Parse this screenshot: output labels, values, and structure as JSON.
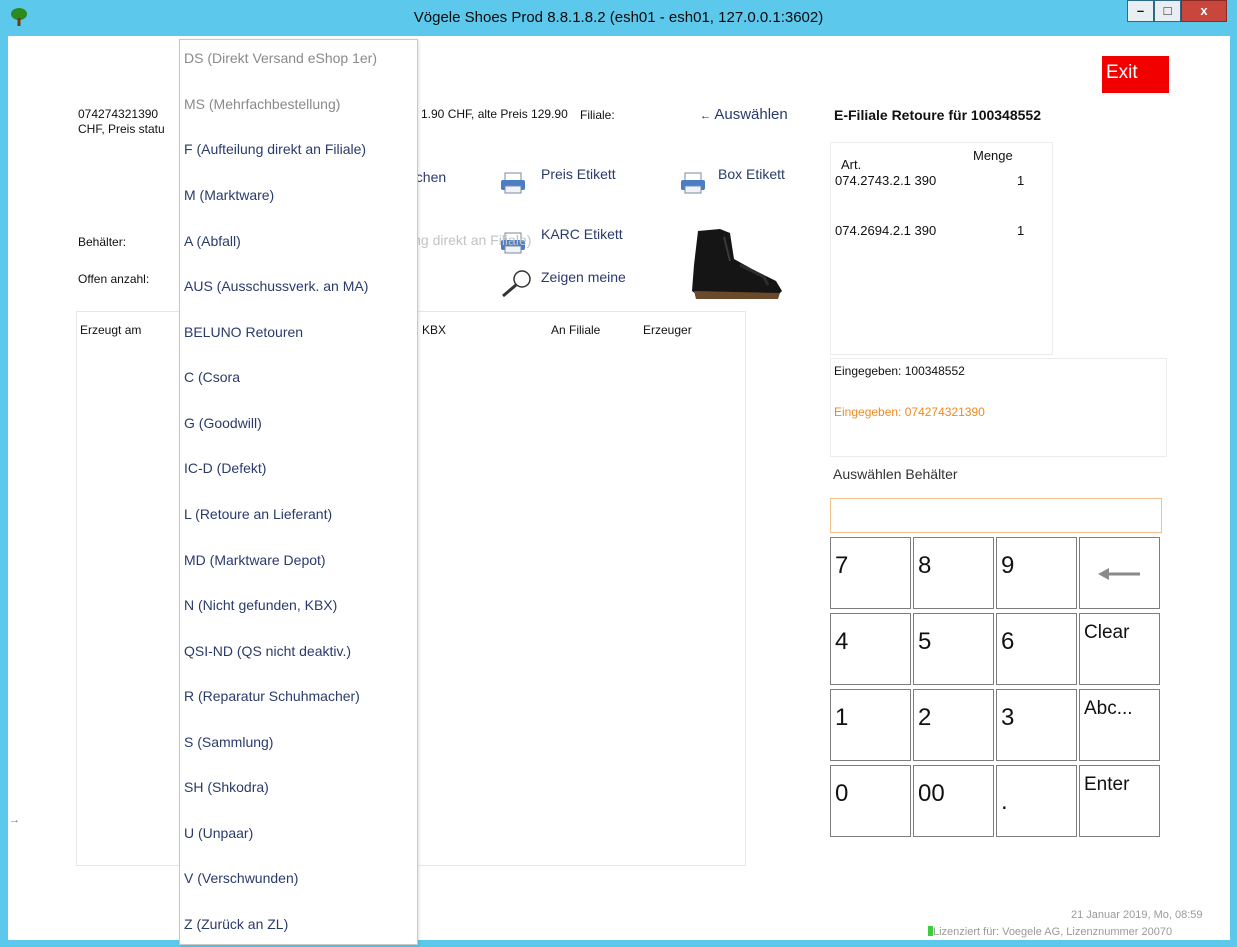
{
  "window": {
    "title": "Vögele Shoes Prod 8.8.1.8.2 (esh01 - esh01, 127.0.0.1:3602)",
    "min_label": "–",
    "max_label": "□",
    "close_label": "x"
  },
  "exit_label": "Exit",
  "product": {
    "code": "074274321390",
    "line2": "CHF, Preis statu",
    "price_text": "1.90 CHF, alte Preis 129.90",
    "filiale_label": "Filiale:",
    "auswaehlen_label": "Auswählen"
  },
  "toolbar": {
    "abbrechen_label": "..bbrechen",
    "preis_etikett": "Preis Etikett",
    "box_etikett": "Box Etikett",
    "karc_etikett": "KARC Etikett",
    "zeigen_meine": "Zeigen meine",
    "hidden_text": "ing direkt an Filiale)"
  },
  "labels": {
    "behaelter": "Behälter:",
    "offen_anzahl": "Offen anzahl:"
  },
  "grid": {
    "columns": [
      "Erzeugt am",
      "KBX",
      "An Filiale",
      "Erzeuger"
    ]
  },
  "dropdown": {
    "items": [
      "DS (Direkt Versand eShop 1er)",
      "MS (Mehrfachbestellung)",
      "F (Aufteilung direkt an Filiale)",
      "M (Marktware)",
      "A (Abfall)",
      "AUS (Ausschussverk. an MA)",
      "BELUNO Retouren",
      "C (Csora",
      "G (Goodwill)",
      "IC-D (Defekt)",
      "L (Retoure an Lieferant)",
      "MD (Marktware Depot)",
      "N (Nicht gefunden, KBX)",
      "QSI-ND (QS nicht deaktiv.)",
      "R (Reparatur Schuhmacher)",
      "S (Sammlung)",
      "SH (Shkodra)",
      "U (Unpaar)",
      "V (Verschwunden)",
      "Z (Zurück an ZL)"
    ]
  },
  "right_panel": {
    "heading": "E-Filiale Retoure für 100348552",
    "art_header": "Art.",
    "menge_header": "Menge",
    "rows": [
      {
        "art": "074.2743.2.1 390",
        "menge": "1"
      },
      {
        "art": "074.2694.2.1 390",
        "menge": "1"
      }
    ],
    "eingegeben_1": "Eingegeben: 100348552",
    "eingegeben_2": "Eingegeben: 074274321390",
    "eingegeben_2_color": "#f08a1c",
    "auswaehlen_behaelter": "Auswählen Behälter",
    "entry_value": ""
  },
  "keypad": {
    "keys": [
      "7",
      "8",
      "9",
      "",
      "4",
      "5",
      "6",
      "Clear",
      "1",
      "2",
      "3",
      "Abc...",
      "0",
      "00",
      ".",
      "Enter"
    ],
    "backspace_icon": "left-arrow-icon"
  },
  "footer": {
    "datetime": "21 Januar 2019, Mo, 08:59",
    "license": "Lizenziert für: Voegele AG, Lizenznummer 20070"
  },
  "colors": {
    "titlebar": "#5bc8ec",
    "exit": "#f20000",
    "link": "#2a3b6b"
  }
}
